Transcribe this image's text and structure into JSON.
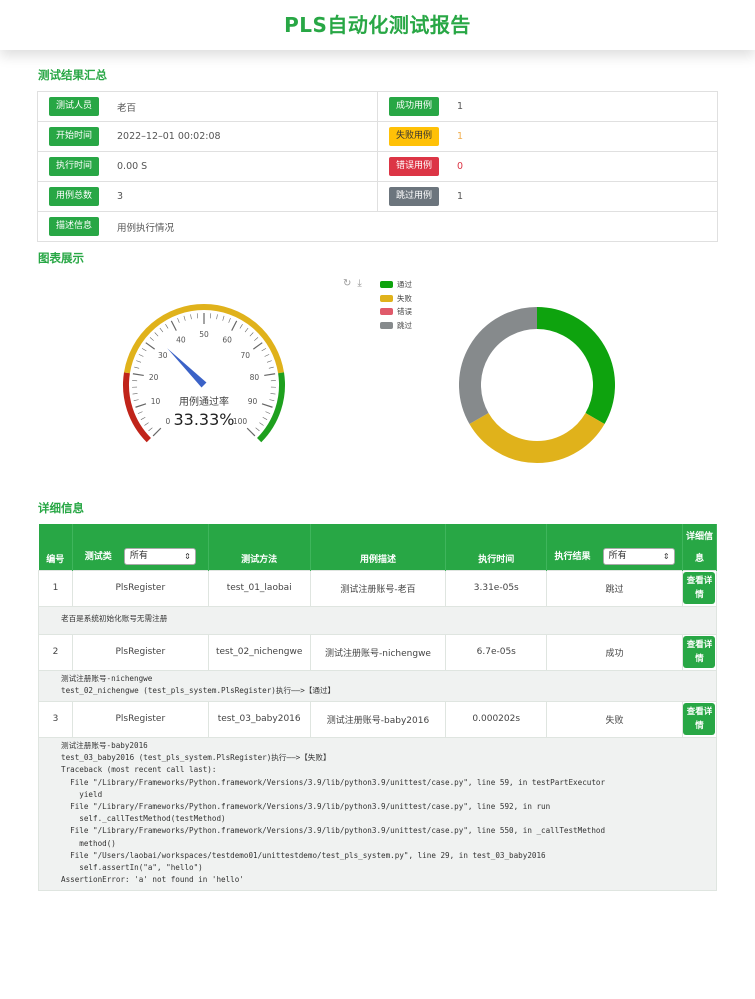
{
  "header": {
    "title": "PLS自动化测试报告"
  },
  "sections": {
    "summary": "测试结果汇总",
    "charts": "图表展示",
    "details": "详细信息"
  },
  "summary": {
    "left": [
      {
        "label": "测试人员",
        "value": "老百"
      },
      {
        "label": "开始时间",
        "value": "2022–12–01 00:02:08"
      },
      {
        "label": "执行时间",
        "value": "0.00 S"
      },
      {
        "label": "用例总数",
        "value": "3"
      }
    ],
    "right": [
      {
        "label": "成功用例",
        "value": "1"
      },
      {
        "label": "失败用例",
        "value": "1"
      },
      {
        "label": "错误用例",
        "value": "0"
      },
      {
        "label": "跳过用例",
        "value": "1"
      }
    ],
    "desc": {
      "label": "描述信息",
      "value": "用例执行情况"
    }
  },
  "gauge": {
    "label": "用例通过率",
    "value_text": "33.33%",
    "value": 33.33,
    "ticks": [
      "0",
      "10",
      "20",
      "30",
      "40",
      "50",
      "60",
      "70",
      "80",
      "90",
      "100"
    ]
  },
  "legend": [
    {
      "name": "通过",
      "color": "#0ea30e"
    },
    {
      "name": "失败",
      "color": "#e0b21b"
    },
    {
      "name": "错误",
      "color": "#e05a6a"
    },
    {
      "name": "跳过",
      "color": "#868a8c"
    }
  ],
  "chart_data": {
    "type": "pie",
    "categories": [
      "通过",
      "失败",
      "错误",
      "跳过"
    ],
    "values": [
      1,
      1,
      0,
      1
    ],
    "colors": [
      "#0ea30e",
      "#e0b21b",
      "#e05a6a",
      "#868a8c"
    ]
  },
  "table": {
    "headers": {
      "id": "编号",
      "cls": "测试类",
      "method": "测试方法",
      "desc": "用例描述",
      "time": "执行时间",
      "result": "执行结果",
      "detail": "详细信息"
    },
    "filter_all": "所有",
    "detail_button": "查看详情",
    "rows": [
      {
        "id": "1",
        "cls": "PlsRegister",
        "method": "test_01_laobai",
        "desc": "测试注册账号-老百",
        "time": "3.31e-05s",
        "result": "跳过",
        "trace": "老百是系统初始化账号无需注册"
      },
      {
        "id": "2",
        "cls": "PlsRegister",
        "method": "test_02_nichengwe",
        "desc": "测试注册账号-nichengwe",
        "time": "6.7e-05s",
        "result": "成功",
        "trace": "测试注册账号-nichengwe\ntest_02_nichengwe (test_pls_system.PlsRegister)执行——>【通过】"
      },
      {
        "id": "3",
        "cls": "PlsRegister",
        "method": "test_03_baby2016",
        "desc": "测试注册账号-baby2016",
        "time": "0.000202s",
        "result": "失败",
        "trace": "测试注册账号-baby2016\ntest_03_baby2016 (test_pls_system.PlsRegister)执行——>【失败】\nTraceback (most recent call last):\n  File \"/Library/Frameworks/Python.framework/Versions/3.9/lib/python3.9/unittest/case.py\", line 59, in testPartExecutor\n    yield\n  File \"/Library/Frameworks/Python.framework/Versions/3.9/lib/python3.9/unittest/case.py\", line 592, in run\n    self._callTestMethod(testMethod)\n  File \"/Library/Frameworks/Python.framework/Versions/3.9/lib/python3.9/unittest/case.py\", line 550, in _callTestMethod\n    method()\n  File \"/Users/laobai/workspaces/testdemo01/unittestdemo/test_pls_system.py\", line 29, in test_03_baby2016\n    self.assertIn(\"a\", \"hello\")\nAssertionError: 'a' not found in 'hello'"
      }
    ]
  }
}
